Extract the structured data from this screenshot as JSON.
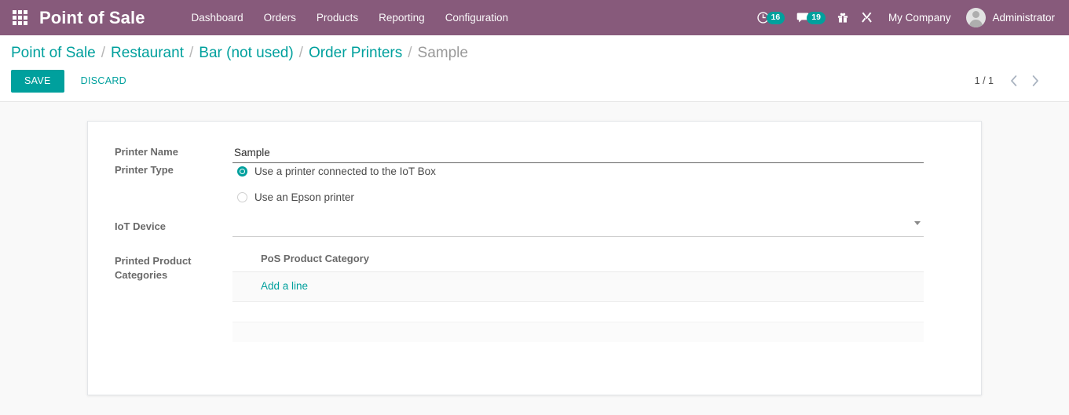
{
  "navbar": {
    "apps_icon": "apps-grid-icon",
    "brand": "Point of Sale",
    "menu_items": [
      {
        "label": "Dashboard"
      },
      {
        "label": "Orders"
      },
      {
        "label": "Products"
      },
      {
        "label": "Reporting"
      },
      {
        "label": "Configuration"
      }
    ],
    "systray": {
      "activities": {
        "icon": "clock-icon",
        "badge": "16"
      },
      "messages": {
        "icon": "chat-bubble-icon",
        "badge": "19"
      },
      "gift": {
        "icon": "gift-icon"
      },
      "debug": {
        "icon": "wrench-tools-icon"
      }
    },
    "company": "My Company",
    "user": "Administrator",
    "accent_purple": "#875A7B",
    "accent_teal": "#00A09D"
  },
  "breadcrumb": {
    "items": [
      {
        "label": "Point of Sale",
        "active": false
      },
      {
        "label": "Restaurant",
        "active": false
      },
      {
        "label": "Bar (not used)",
        "active": false
      },
      {
        "label": "Order Printers",
        "active": false
      },
      {
        "label": "Sample",
        "active": true
      }
    ],
    "separator": "/"
  },
  "toolbar": {
    "save_label": "SAVE",
    "discard_label": "DISCARD"
  },
  "pager": {
    "value": "1 / 1",
    "prev_icon": "chevron-left-icon",
    "next_icon": "chevron-right-icon"
  },
  "form": {
    "printer_name": {
      "label": "Printer Name",
      "value": "Sample",
      "placeholder": ""
    },
    "printer_type": {
      "label": "Printer Type",
      "options": [
        {
          "label": "Use a printer connected to the IoT Box",
          "selected": true
        },
        {
          "label": "Use an Epson printer",
          "selected": false
        }
      ]
    },
    "iot_device": {
      "label": "IoT Device",
      "value": "",
      "placeholder": "",
      "caret_icon": "chevron-down-icon"
    },
    "printed_product_categories": {
      "label": "Printed Product Categories",
      "column_header": "PoS Product Category",
      "rows": [],
      "add_line_label": "Add a line"
    }
  }
}
